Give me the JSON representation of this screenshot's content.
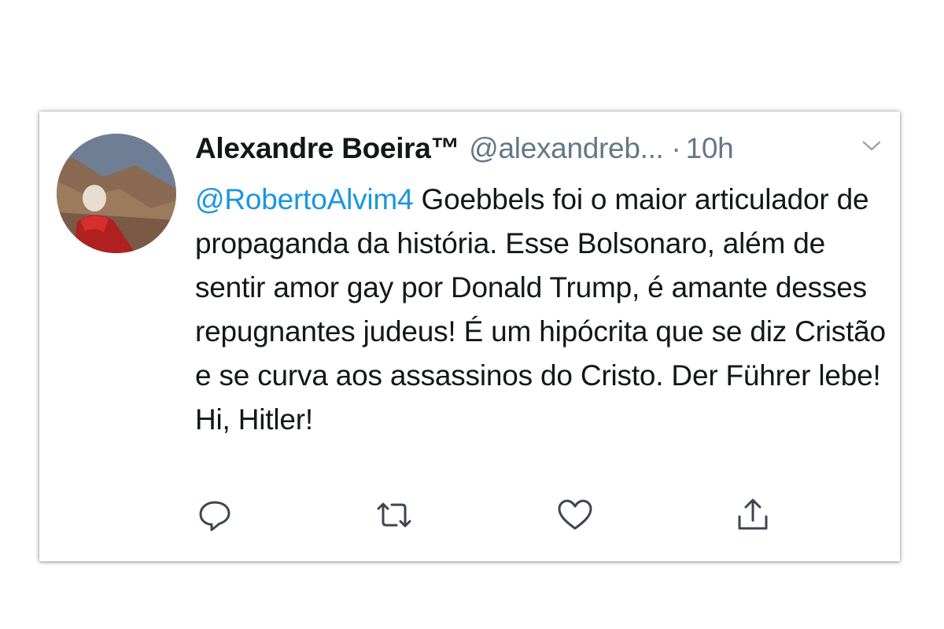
{
  "tweet": {
    "author_name": "Alexandre Boeira™",
    "author_handle": "@alexandreb...",
    "separator": "·",
    "time": "10h",
    "mention": "@RobertoAlvim4",
    "body": " Goebbels foi o maior articulador de propaganda da história. Esse Bolsonaro, além de sentir amor gay por Donald Trump, é amante desses repugnantes judeus! É um hipócrita que se diz Cristão e se curva aos assassinos do Cristo. Der Führer lebe! Hi, Hitler!"
  },
  "icons": {
    "more": "chevron-down-icon",
    "reply": "reply-icon",
    "retweet": "retweet-icon",
    "like": "heart-icon",
    "share": "share-icon"
  },
  "colors": {
    "text": "#14171a",
    "secondary": "#657786",
    "link": "#1b95e0",
    "background": "#ffffff"
  }
}
